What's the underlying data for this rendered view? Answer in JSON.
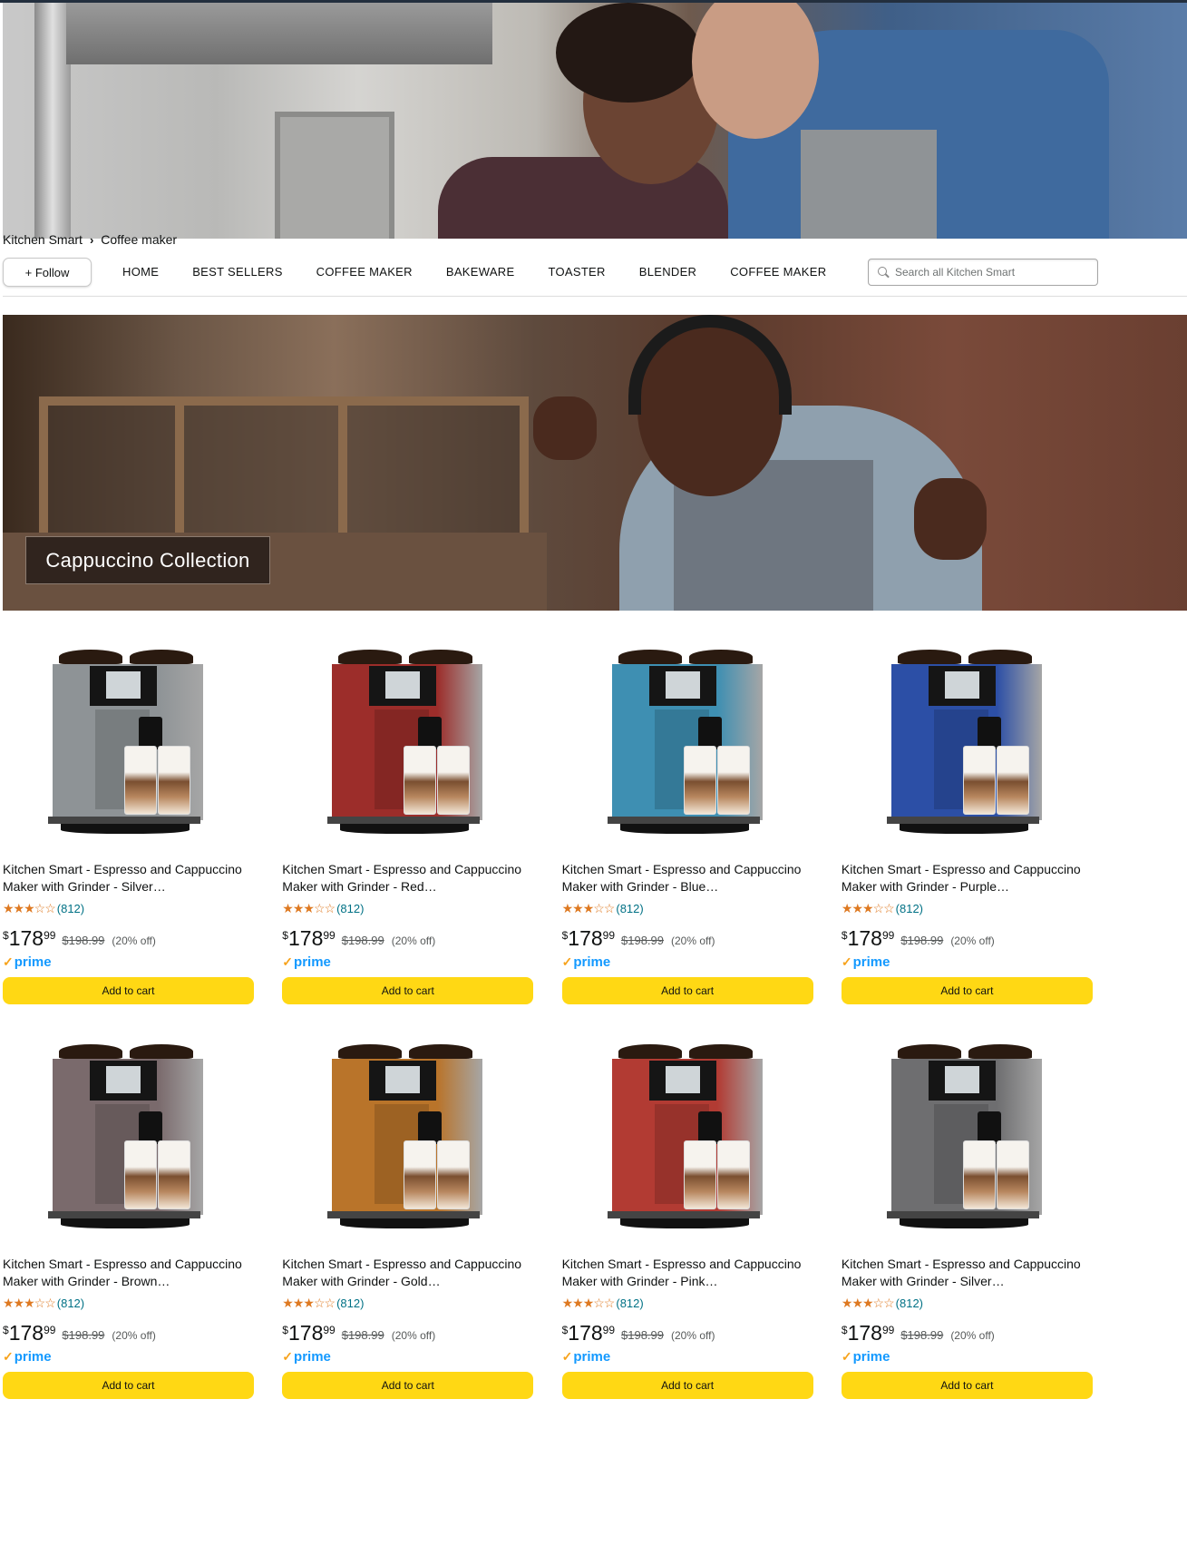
{
  "colors": {
    "accent_cart": "#FFD814",
    "prime_blue": "#1399FF",
    "star": "#DE7921",
    "link": "#007185"
  },
  "breadcrumb": {
    "store": "Kitchen Smart",
    "separator_icon": "chevron-right-icon",
    "current": "Coffee maker"
  },
  "nav": {
    "follow_label": "+ Follow",
    "links": [
      "HOME",
      "BEST SELLERS",
      "COFFEE MAKER",
      "BAKEWARE",
      "TOASTER",
      "BLENDER",
      "COFFEE MAKER"
    ],
    "search_placeholder": "Search all Kitchen Smart",
    "search_icon": "search-icon"
  },
  "banner": {
    "title": "Cappuccino Collection"
  },
  "products": [
    {
      "title": "Kitchen Smart - Espresso and Cappuccino Maker with Grinder - Silver…",
      "rating": 2.5,
      "stars": "★★★☆☆",
      "count": "(812)",
      "symbol": "$",
      "whole": "178",
      "fraction": "99",
      "list_price": "$198.99",
      "discount": "(20% off)",
      "prime": "prime",
      "cart_label": "Add to cart",
      "color": "#8e9396"
    },
    {
      "title": "Kitchen Smart - Espresso and Cappuccino Maker with Grinder - Red…",
      "rating": 2.5,
      "stars": "★★★☆☆",
      "count": "(812)",
      "symbol": "$",
      "whole": "178",
      "fraction": "99",
      "list_price": "$198.99",
      "discount": "(20% off)",
      "prime": "prime",
      "cart_label": "Add to cart",
      "color": "#9c2d2a"
    },
    {
      "title": "Kitchen Smart - Espresso and Cappuccino Maker with Grinder - Blue…",
      "rating": 2.5,
      "stars": "★★★☆☆",
      "count": "(812)",
      "symbol": "$",
      "whole": "178",
      "fraction": "99",
      "list_price": "$198.99",
      "discount": "(20% off)",
      "prime": "prime",
      "cart_label": "Add to cart",
      "color": "#3e8fb2"
    },
    {
      "title": "Kitchen Smart - Espresso and Cappuccino Maker with Grinder - Purple…",
      "rating": 2.5,
      "stars": "★★★☆☆",
      "count": "(812)",
      "symbol": "$",
      "whole": "178",
      "fraction": "99",
      "list_price": "$198.99",
      "discount": "(20% off)",
      "prime": "prime",
      "cart_label": "Add to cart",
      "color": "#2c4fa6"
    },
    {
      "title": "Kitchen Smart - Espresso and Cappuccino Maker with Grinder - Brown…",
      "rating": 2.5,
      "stars": "★★★☆☆",
      "count": "(812)",
      "symbol": "$",
      "whole": "178",
      "fraction": "99",
      "list_price": "$198.99",
      "discount": "(20% off)",
      "prime": "prime",
      "cart_label": "Add to cart",
      "color": "#7a6a6c"
    },
    {
      "title": "Kitchen Smart - Espresso and Cappuccino Maker with Grinder - Gold…",
      "rating": 2.5,
      "stars": "★★★☆☆",
      "count": "(812)",
      "symbol": "$",
      "whole": "178",
      "fraction": "99",
      "list_price": "$198.99",
      "discount": "(20% off)",
      "prime": "prime",
      "cart_label": "Add to cart",
      "color": "#b9742a"
    },
    {
      "title": "Kitchen Smart - Espresso and Cappuccino Maker with Grinder - Pink…",
      "rating": 2.5,
      "stars": "★★★☆☆",
      "count": "(812)",
      "symbol": "$",
      "whole": "178",
      "fraction": "99",
      "list_price": "$198.99",
      "discount": "(20% off)",
      "prime": "prime",
      "cart_label": "Add to cart",
      "color": "#b23b33"
    },
    {
      "title": "Kitchen Smart - Espresso and Cappuccino Maker with Grinder - Silver…",
      "rating": 2.5,
      "stars": "★★★☆☆",
      "count": "(812)",
      "symbol": "$",
      "whole": "178",
      "fraction": "99",
      "list_price": "$198.99",
      "discount": "(20% off)",
      "prime": "prime",
      "cart_label": "Add to cart",
      "color": "#6e6e70"
    }
  ]
}
